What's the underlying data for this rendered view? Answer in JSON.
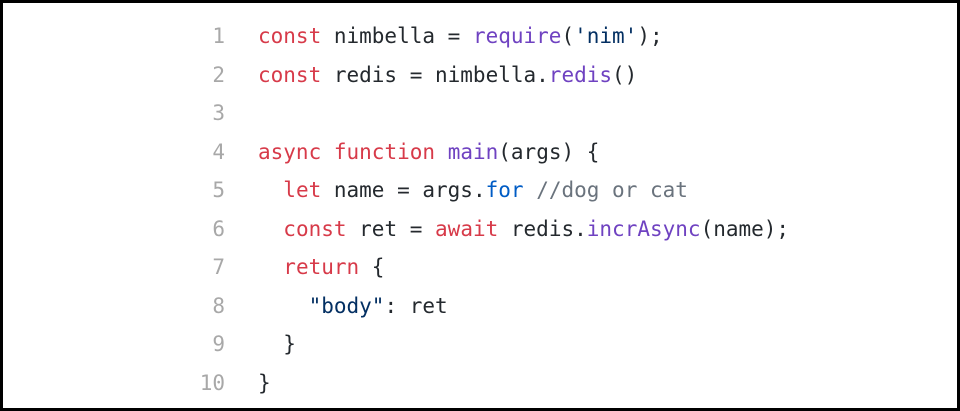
{
  "colors": {
    "keyword": "#d73a49",
    "function": "#6f42c1",
    "string": "#032f62",
    "property": "#005cc5",
    "comment": "#6a737d",
    "plain": "#24292e",
    "line_number": "#a8a8a8",
    "border": "#000000",
    "background": "#ffffff"
  },
  "code": {
    "lines": [
      {
        "number": "1",
        "tokens": [
          {
            "text": "const",
            "type": "kw"
          },
          {
            "text": " nimbella = ",
            "type": "plain"
          },
          {
            "text": "require",
            "type": "fn"
          },
          {
            "text": "(",
            "type": "plain"
          },
          {
            "text": "'nim'",
            "type": "str"
          },
          {
            "text": ");",
            "type": "plain"
          }
        ]
      },
      {
        "number": "2",
        "tokens": [
          {
            "text": "const",
            "type": "kw"
          },
          {
            "text": " redis = nimbella.",
            "type": "plain"
          },
          {
            "text": "redis",
            "type": "fn"
          },
          {
            "text": "()",
            "type": "plain"
          }
        ]
      },
      {
        "number": "3",
        "tokens": []
      },
      {
        "number": "4",
        "tokens": [
          {
            "text": "async",
            "type": "kw"
          },
          {
            "text": " ",
            "type": "plain"
          },
          {
            "text": "function",
            "type": "kw"
          },
          {
            "text": " ",
            "type": "plain"
          },
          {
            "text": "main",
            "type": "fn"
          },
          {
            "text": "(args) {",
            "type": "plain"
          }
        ]
      },
      {
        "number": "5",
        "tokens": [
          {
            "text": "  ",
            "type": "plain"
          },
          {
            "text": "let",
            "type": "kw"
          },
          {
            "text": " name = args.",
            "type": "plain"
          },
          {
            "text": "for",
            "type": "prop"
          },
          {
            "text": " ",
            "type": "plain"
          },
          {
            "text": "//dog or cat",
            "type": "cm"
          }
        ]
      },
      {
        "number": "6",
        "tokens": [
          {
            "text": "  ",
            "type": "plain"
          },
          {
            "text": "const",
            "type": "kw"
          },
          {
            "text": " ret = ",
            "type": "plain"
          },
          {
            "text": "await",
            "type": "kw"
          },
          {
            "text": " redis.",
            "type": "plain"
          },
          {
            "text": "incrAsync",
            "type": "fn"
          },
          {
            "text": "(name);",
            "type": "plain"
          }
        ]
      },
      {
        "number": "7",
        "tokens": [
          {
            "text": "  ",
            "type": "plain"
          },
          {
            "text": "return",
            "type": "kw"
          },
          {
            "text": " {",
            "type": "plain"
          }
        ]
      },
      {
        "number": "8",
        "tokens": [
          {
            "text": "    ",
            "type": "plain"
          },
          {
            "text": "\"body\"",
            "type": "str"
          },
          {
            "text": ": ret",
            "type": "plain"
          }
        ]
      },
      {
        "number": "9",
        "tokens": [
          {
            "text": "  }",
            "type": "plain"
          }
        ]
      },
      {
        "number": "10",
        "tokens": [
          {
            "text": "}",
            "type": "plain"
          }
        ]
      }
    ]
  }
}
